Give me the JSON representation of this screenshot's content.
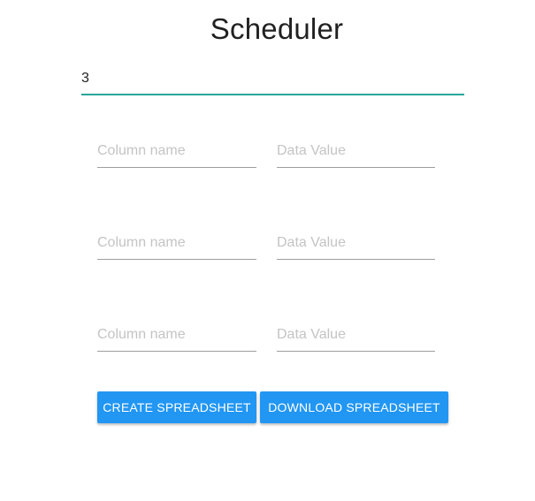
{
  "header": {
    "title": "Scheduler"
  },
  "row_count_input": {
    "value": "3"
  },
  "rows": [
    {
      "column_placeholder": "Column name",
      "value_placeholder": "Data Value"
    },
    {
      "column_placeholder": "Column name",
      "value_placeholder": "Data Value"
    },
    {
      "column_placeholder": "Column name",
      "value_placeholder": "Data Value"
    }
  ],
  "actions": {
    "create_label": "CREATE SPREADSHEET",
    "download_label": "DOWNLOAD SPREADSHEET"
  },
  "colors": {
    "accent_underline": "#26a69a",
    "button_primary": "#2196f3"
  }
}
